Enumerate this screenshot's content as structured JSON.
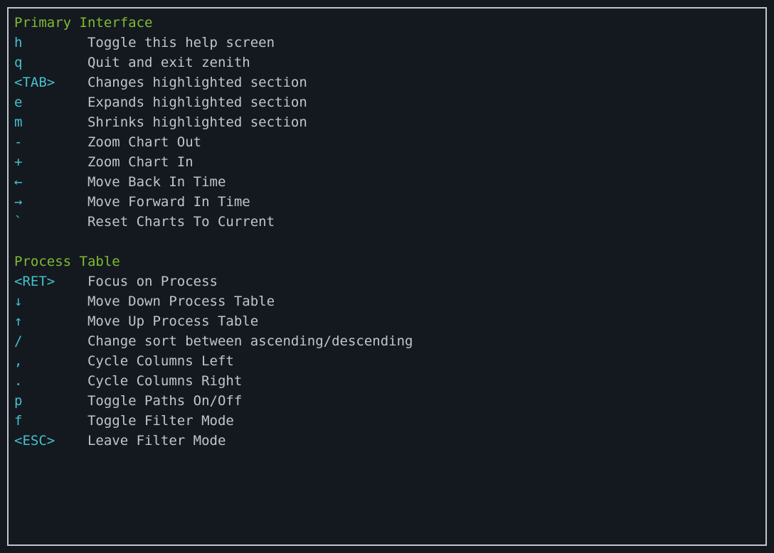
{
  "sections": [
    {
      "title": "Primary Interface",
      "bindings": [
        {
          "key": "h",
          "desc": "Toggle this help screen"
        },
        {
          "key": "q",
          "desc": "Quit and exit zenith"
        },
        {
          "key": "<TAB>",
          "desc": "Changes highlighted section"
        },
        {
          "key": "e",
          "desc": "Expands highlighted section"
        },
        {
          "key": "m",
          "desc": "Shrinks highlighted section"
        },
        {
          "key": "-",
          "desc": "Zoom Chart Out"
        },
        {
          "key": "+",
          "desc": "Zoom Chart In"
        },
        {
          "key": "←",
          "desc": "Move Back In Time"
        },
        {
          "key": "→",
          "desc": "Move Forward In Time"
        },
        {
          "key": "`",
          "desc": "Reset Charts To Current"
        }
      ]
    },
    {
      "title": "Process Table",
      "bindings": [
        {
          "key": "<RET>",
          "desc": "Focus on Process"
        },
        {
          "key": "↓",
          "desc": "Move Down Process Table"
        },
        {
          "key": "↑",
          "desc": "Move Up Process Table"
        },
        {
          "key": "/",
          "desc": "Change sort between ascending/descending"
        },
        {
          "key": ",",
          "desc": "Cycle Columns Left"
        },
        {
          "key": ".",
          "desc": "Cycle Columns Right"
        },
        {
          "key": "p",
          "desc": "Toggle Paths On/Off"
        },
        {
          "key": "f",
          "desc": "Toggle Filter Mode"
        },
        {
          "key": "<ESC>",
          "desc": "Leave Filter Mode"
        }
      ]
    }
  ]
}
